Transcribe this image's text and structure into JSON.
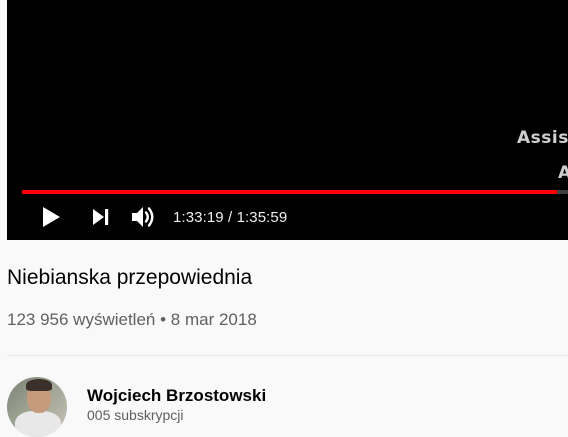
{
  "player": {
    "overlay_lines": [
      "Assist",
      "A"
    ],
    "progress": 0.9797,
    "current_time": "1:33:19",
    "total_time": "1:35:59",
    "time_separator": " / ",
    "icons": {
      "play": "play-icon",
      "next": "next-icon",
      "volume": "volume-icon"
    },
    "colors": {
      "progress": "#ff0000",
      "background": "#000000"
    }
  },
  "video": {
    "title": "Niebianska przepowiednia",
    "views": "123 956 wyświetleń",
    "bullet": "•",
    "date": "8 mar 2018"
  },
  "channel": {
    "name": "Wojciech Brzostowski",
    "subscribers": "005 subskrypcji"
  }
}
